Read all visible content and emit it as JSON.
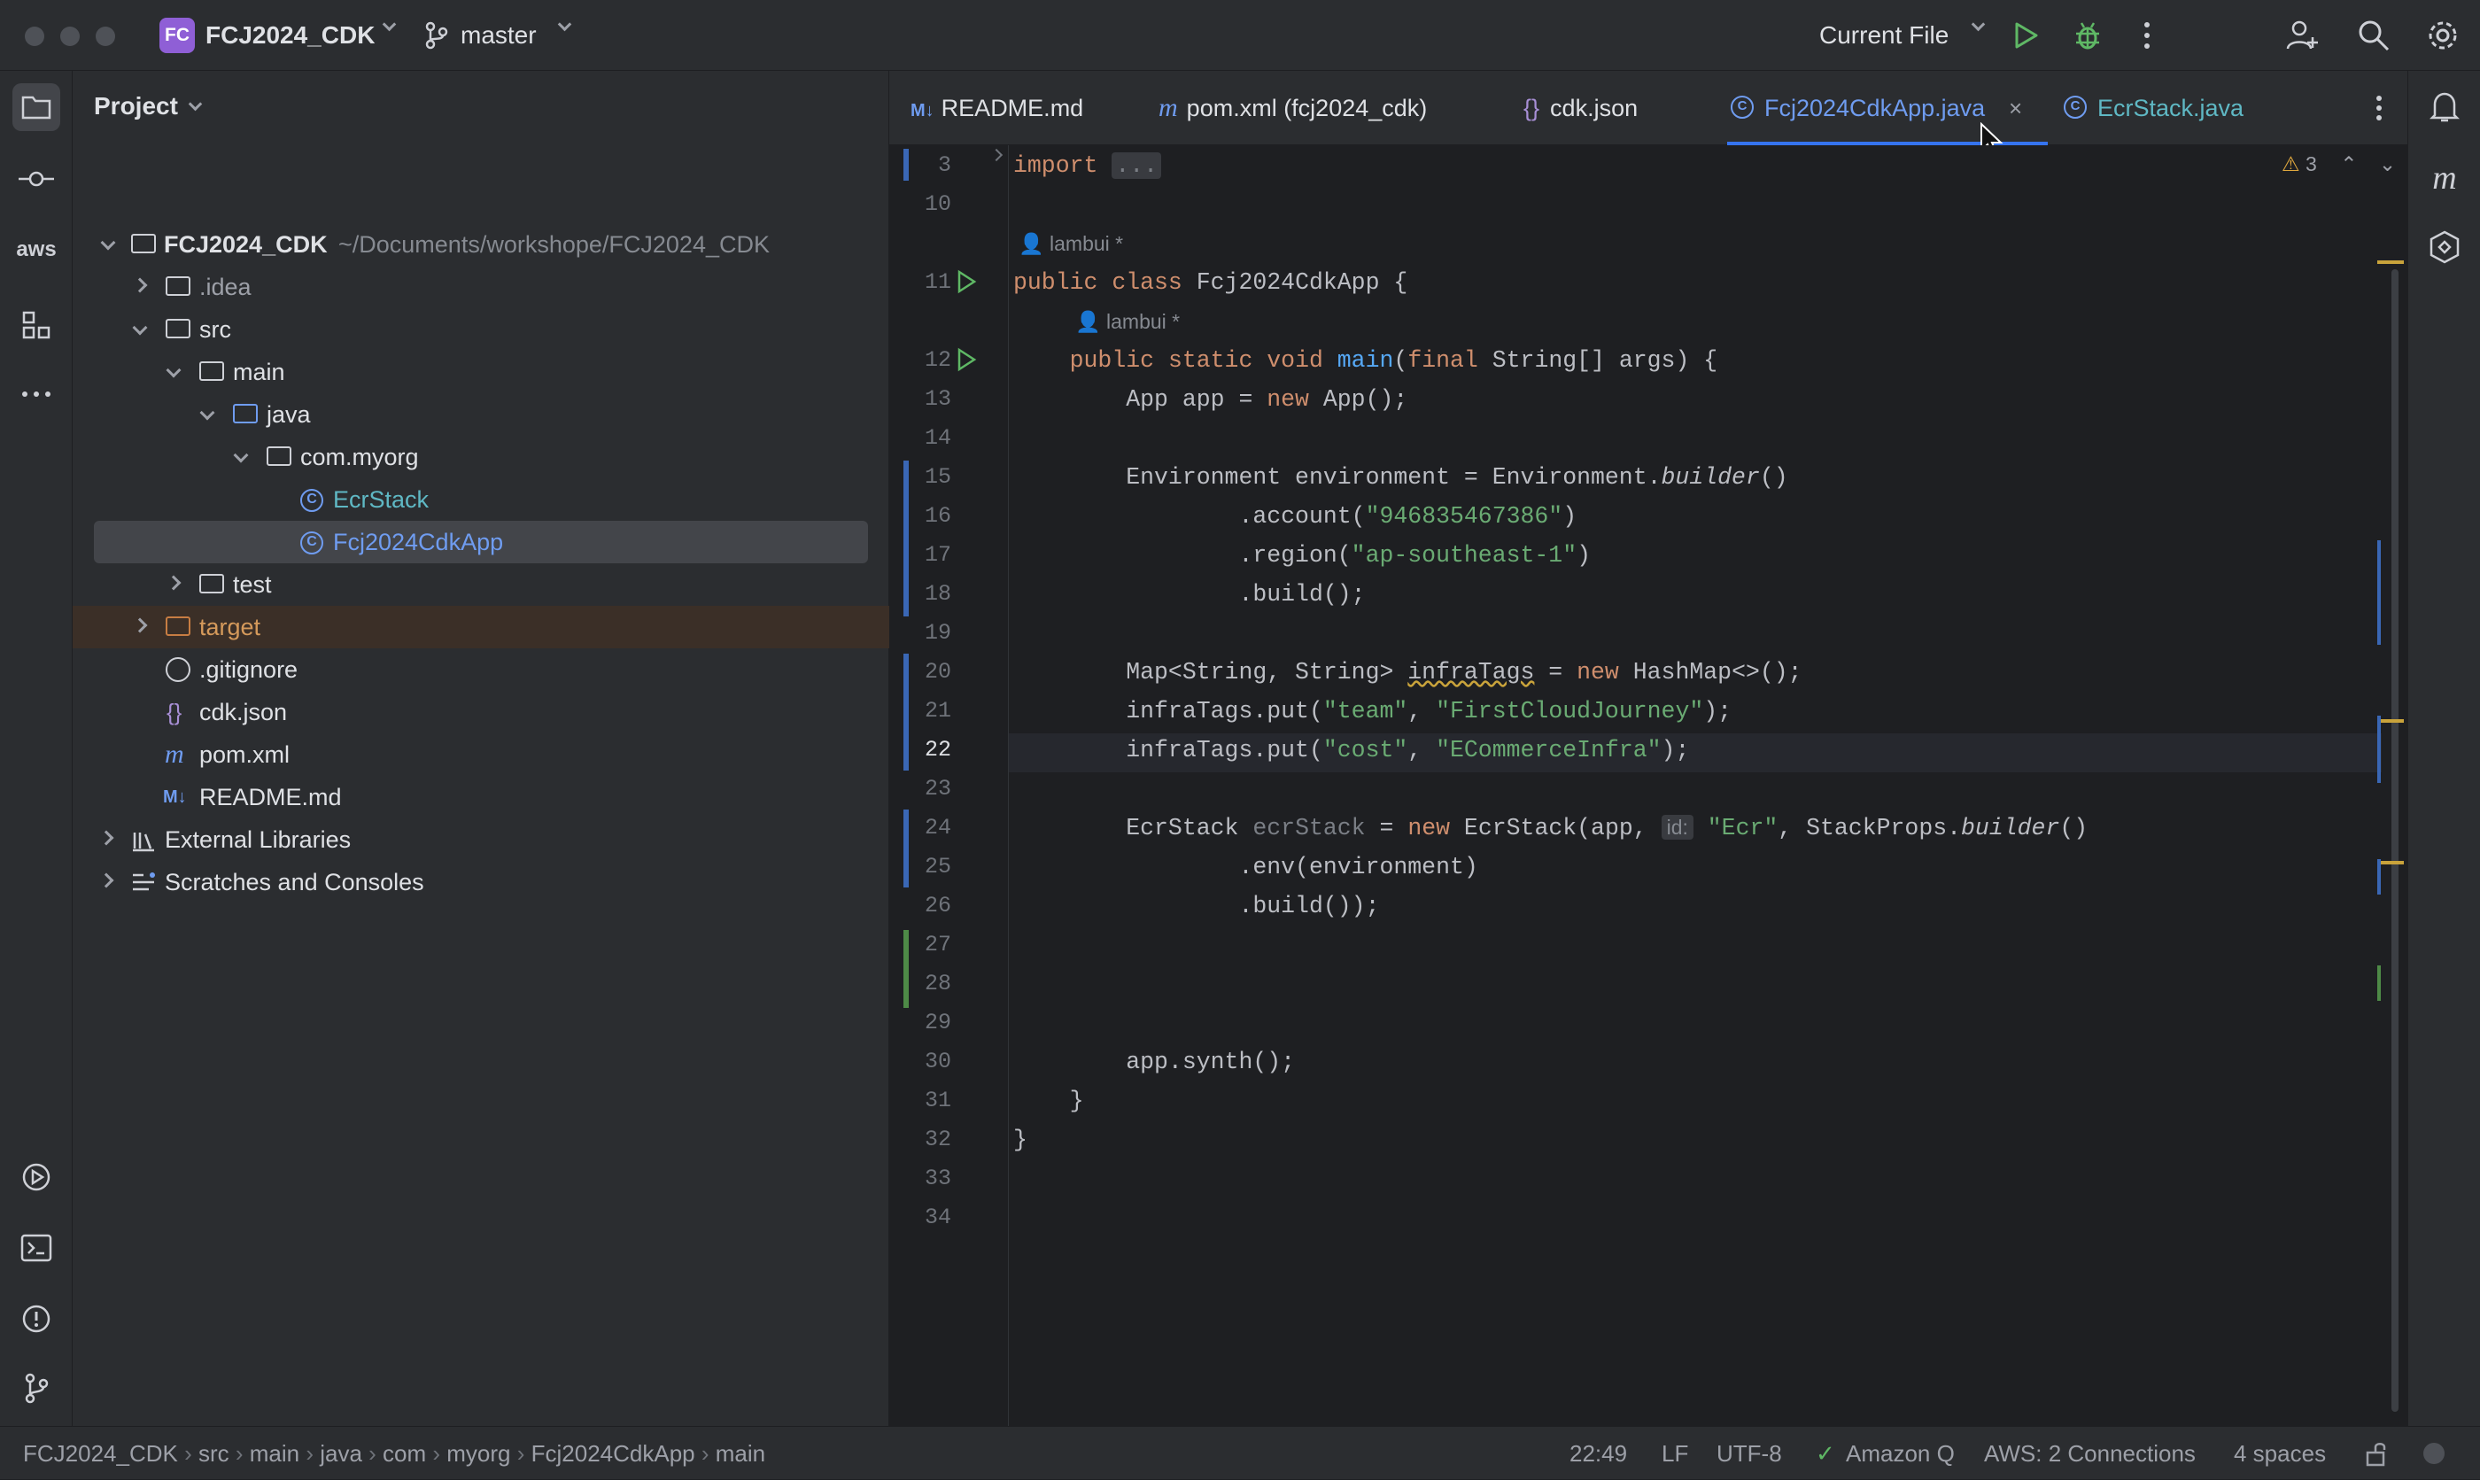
{
  "titlebar": {
    "project_badge": "FC",
    "project_name": "FCJ2024_CDK",
    "branch": "master",
    "run_config": "Current File"
  },
  "project_panel": {
    "title": "Project",
    "tree": [
      {
        "label": "FCJ2024_CDK",
        "path": "~/Documents/workshope/FCJ2024_CDK"
      },
      {
        "label": ".idea"
      },
      {
        "label": "src"
      },
      {
        "label": "main"
      },
      {
        "label": "java"
      },
      {
        "label": "com.myorg"
      },
      {
        "label": "EcrStack"
      },
      {
        "label": "Fcj2024CdkApp"
      },
      {
        "label": "test"
      },
      {
        "label": "target"
      },
      {
        "label": ".gitignore"
      },
      {
        "label": "cdk.json"
      },
      {
        "label": "pom.xml"
      },
      {
        "label": "README.md"
      },
      {
        "label": "External Libraries"
      },
      {
        "label": "Scratches and Consoles"
      }
    ]
  },
  "tabs": [
    {
      "label": "README.md",
      "icon": "markdown-icon"
    },
    {
      "label": "pom.xml (fcj2024_cdk)",
      "icon": "maven-icon"
    },
    {
      "label": "cdk.json",
      "icon": "json-icon"
    },
    {
      "label": "Fcj2024CdkApp.java",
      "icon": "class-icon",
      "active": true
    },
    {
      "label": "EcrStack.java",
      "icon": "class-icon"
    }
  ],
  "editor": {
    "warnings_count": "3",
    "author_hint": "lambui *",
    "line_numbers": [
      "3",
      "10",
      "11",
      "12",
      "13",
      "14",
      "15",
      "16",
      "17",
      "18",
      "19",
      "20",
      "21",
      "22",
      "23",
      "24",
      "25",
      "26",
      "27",
      "28",
      "29",
      "30",
      "31",
      "32",
      "33",
      "34"
    ],
    "param_hint": "id:"
  },
  "statusbar": {
    "breadcrumb": [
      "FCJ2024_CDK",
      "src",
      "main",
      "java",
      "com",
      "myorg",
      "Fcj2024CdkApp",
      "main"
    ],
    "position": "22:49",
    "line_sep": "LF",
    "encoding": "UTF-8",
    "amazon_q": "Amazon Q",
    "aws": "AWS: 2 Connections",
    "indent": "4 spaces"
  },
  "colors": {
    "background": "#1e1f22",
    "panel": "#2b2d30",
    "keyword": "#cf8e6d",
    "string": "#6aab73",
    "function": "#56a8f5",
    "class_blue": "#6f9cf0"
  }
}
